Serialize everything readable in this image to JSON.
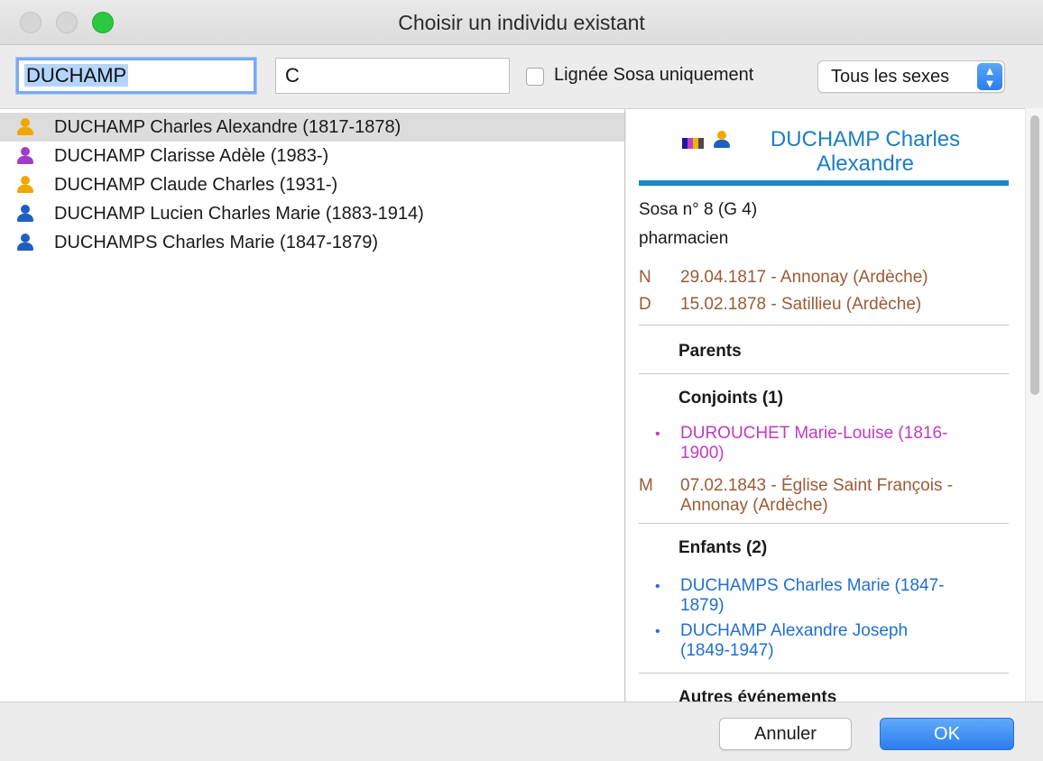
{
  "window": {
    "title": "Choisir un individu existant"
  },
  "search": {
    "name_value": "DUCHAMP",
    "firstname_value": "C",
    "sosa_only_label": "Lignée Sosa uniquement",
    "sosa_only_checked": false,
    "sex_filter_value": "Tous les sexes"
  },
  "colors": {
    "male": "#1f5fbf",
    "female": "#a23cc8",
    "unknown_sex": "#f0a800",
    "link_blue": "#1f6fd0",
    "event_brown": "#9b5a35",
    "accent": "#1a86c8"
  },
  "results": [
    {
      "label": "DUCHAMP Charles Alexandre (1817-1878)",
      "icon": "person-icon-mixed",
      "selected": true
    },
    {
      "label": "DUCHAMP Clarisse Adèle (1983-)",
      "icon": "person-icon-female",
      "selected": false
    },
    {
      "label": "DUCHAMP Claude Charles (1931-)",
      "icon": "person-icon-mixed",
      "selected": false
    },
    {
      "label": "DUCHAMP Lucien Charles Marie (1883-1914)",
      "icon": "person-icon-male",
      "selected": false
    },
    {
      "label": "DUCHAMPS Charles Marie (1847-1879)",
      "icon": "person-icon-male",
      "selected": false
    }
  ],
  "detail": {
    "name_line1": "DUCHAMP Charles",
    "name_line2": "Alexandre",
    "sosa": "Sosa n° 8 (G 4)",
    "occupation": "pharmacien",
    "birth_tag": "N",
    "birth": "29.04.1817 - Annonay (Ardèche)",
    "death_tag": "D",
    "death": "15.02.1878 - Satillieu (Ardèche)",
    "parents_heading": "Parents",
    "spouses_heading": "Conjoints (1)",
    "spouse_line1": "DUROUCHET Marie-Louise (1816-",
    "spouse_line2": "1900)",
    "marriage_tag": "M",
    "marriage_line1": "07.02.1843 - Église Saint François -",
    "marriage_line2": "Annonay (Ardèche)",
    "children_heading": "Enfants (2)",
    "child1_line1": "DUCHAMPS Charles Marie (1847-",
    "child1_line2": "1879)",
    "child2_line1": "DUCHAMP Alexandre Joseph",
    "child2_line2": "(1849-1947)",
    "other_events_heading": "Autres événements"
  },
  "footer": {
    "cancel_label": "Annuler",
    "ok_label": "OK"
  }
}
